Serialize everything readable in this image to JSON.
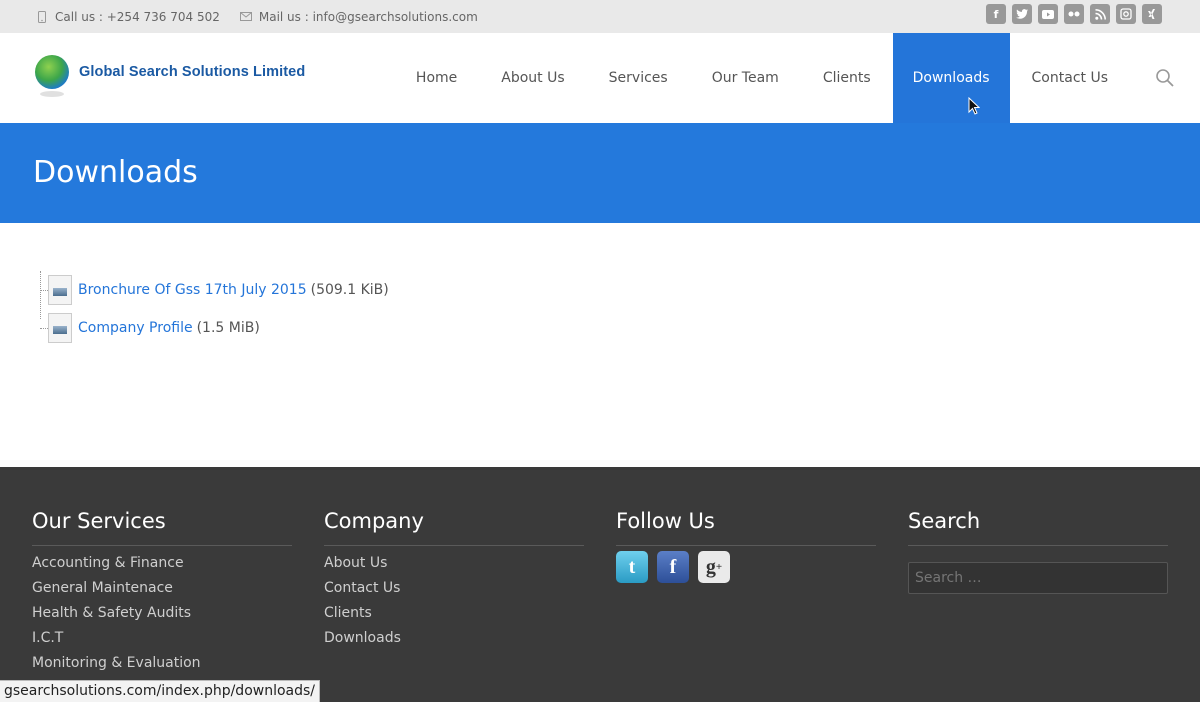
{
  "topbar": {
    "phone_text": "Call us : +254 736 704 502",
    "mail_text": "Mail us : info@gsearchsolutions.com",
    "social_icons": [
      "facebook-icon",
      "twitter-icon",
      "youtube-icon",
      "flickr-icon",
      "rss-icon",
      "instagram-icon",
      "xing-icon"
    ]
  },
  "header": {
    "logo_text": "Global Search Solutions Limited",
    "nav": [
      "Home",
      "About Us",
      "Services",
      "Our Team",
      "Clients",
      "Downloads",
      "Contact Us"
    ]
  },
  "page": {
    "title": "Downloads",
    "files": [
      {
        "name": "Bronchure Of Gss 17th July 2015",
        "size": "(509.1 KiB)"
      },
      {
        "name": "Company Profile",
        "size": "(1.5 MiB)"
      }
    ]
  },
  "footer": {
    "services": {
      "heading": "Our Services",
      "items": [
        "Accounting & Finance",
        "General Maintenace",
        "Health & Safety Audits",
        "I.C.T",
        "Monitoring & Evaluation"
      ]
    },
    "company": {
      "heading": "Company",
      "items": [
        "About Us",
        "Contact Us",
        "Clients",
        "Downloads"
      ]
    },
    "follow": {
      "heading": "Follow Us",
      "icons": [
        "twitter-icon",
        "facebook-icon",
        "google-plus-icon"
      ]
    },
    "search": {
      "heading": "Search",
      "placeholder": "Search …"
    }
  },
  "statusbar": {
    "url": "gsearchsolutions.com/index.php/downloads/"
  },
  "colors": {
    "accent": "#2479dc",
    "footer_bg": "#3a3a3a",
    "topbar_bg": "#e9e9e9"
  }
}
